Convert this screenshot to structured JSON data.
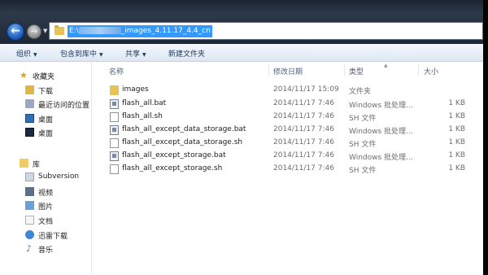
{
  "address": {
    "path_prefix": "E:\\",
    "path_suffix": "_images_4.11.17_4.4_cn"
  },
  "toolbar": {
    "organize": "组织",
    "include_in_library": "包含到库中",
    "share": "共享",
    "new_folder": "新建文件夹"
  },
  "nav": {
    "favorites": "收藏夹",
    "downloads": "下载",
    "recent": "最近访问的位置",
    "desktop1": "桌面",
    "desktop2": "桌面",
    "libraries": "库",
    "subversion": "Subversion",
    "videos": "视频",
    "pictures": "图片",
    "documents": "文档",
    "thunder": "迅雷下载",
    "music": "音乐"
  },
  "columns": {
    "name": "名称",
    "modified": "修改日期",
    "type": "类型",
    "size": "大小"
  },
  "files": [
    {
      "name": "images",
      "modified": "2014/11/17 15:09",
      "type": "文件夹",
      "size": ""
    },
    {
      "name": "flash_all.bat",
      "modified": "2014/11/17 7:46",
      "type": "Windows 批处理...",
      "size": "1 KB"
    },
    {
      "name": "flash_all.sh",
      "modified": "2014/11/17 7:46",
      "type": "SH 文件",
      "size": "1 KB"
    },
    {
      "name": "flash_all_except_data_storage.bat",
      "modified": "2014/11/17 7:46",
      "type": "Windows 批处理...",
      "size": "1 KB"
    },
    {
      "name": "flash_all_except_data_storage.sh",
      "modified": "2014/11/17 7:46",
      "type": "SH 文件",
      "size": "1 KB"
    },
    {
      "name": "flash_all_except_storage.bat",
      "modified": "2014/11/17 7:46",
      "type": "Windows 批处理...",
      "size": "1 KB"
    },
    {
      "name": "flash_all_except_storage.sh",
      "modified": "2014/11/17 7:46",
      "type": "SH 文件",
      "size": "1 KB"
    }
  ]
}
